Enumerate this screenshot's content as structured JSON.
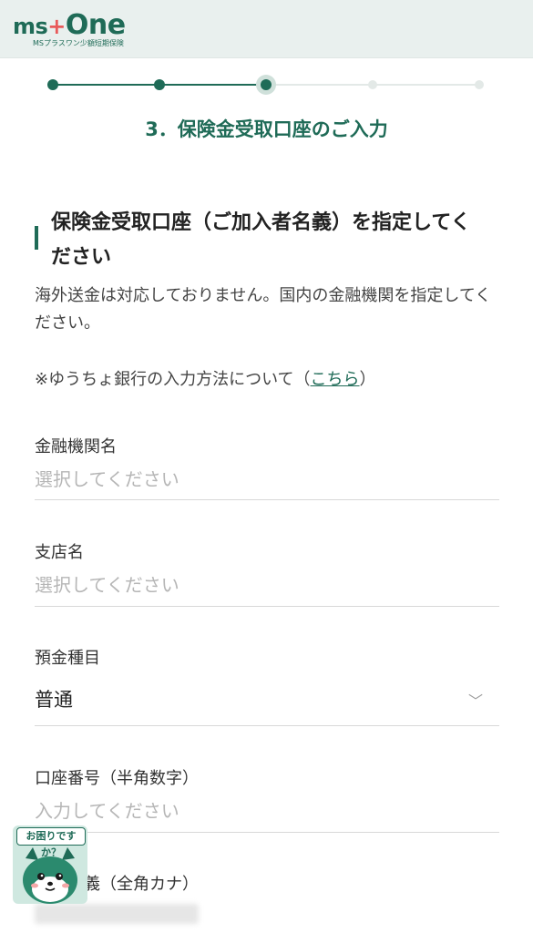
{
  "header": {
    "logo_main_prefix": "ms",
    "logo_plus": "+",
    "logo_one": "One",
    "logo_sub": "MSプラスワン少額短期保険"
  },
  "stepper": {
    "total_steps": 5,
    "current_step": 3
  },
  "step_title": "3．保険金受取口座のご入力",
  "section": {
    "heading": "保険金受取口座（ご加入者名義）を指定してください"
  },
  "description": "海外送金は対応しておりません。国内の金融機関を指定してください。",
  "note": {
    "prefix": "※ゆうちょ銀行の入力方法について（",
    "link": "こちら",
    "suffix": "）"
  },
  "fields": {
    "bank_name": {
      "label": "金融機関名",
      "placeholder": "選択してください"
    },
    "branch_name": {
      "label": "支店名",
      "placeholder": "選択してください"
    },
    "deposit_type": {
      "label": "預金種目",
      "value": "普通"
    },
    "account_number": {
      "label": "口座番号（半角数字）",
      "placeholder": "入力してください"
    },
    "account_holder": {
      "label_partial": "名義（全角カナ）"
    }
  },
  "help_widget": {
    "bubble": "お困りですか？",
    "icon": "mascot-icon"
  },
  "colors": {
    "brand_green": "#1f6b57",
    "header_bg": "#e9f0ee",
    "placeholder": "#b6b6b6",
    "logo_plus": "#e85a5a"
  }
}
